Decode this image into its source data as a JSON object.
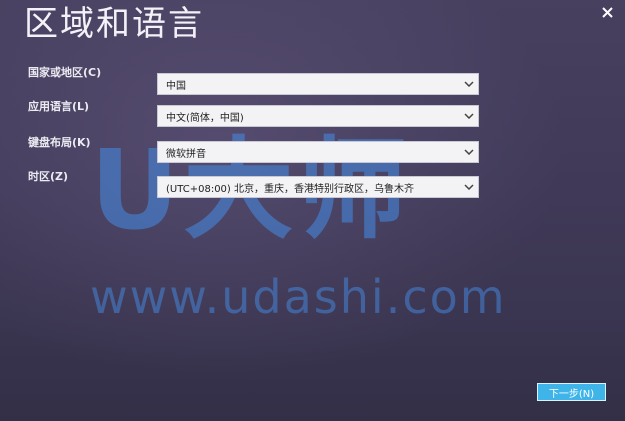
{
  "window": {
    "title": "区域和语言"
  },
  "fields": [
    {
      "label": "国家或地区(C)",
      "value": "中国"
    },
    {
      "label": "应用语言(L)",
      "value": "中文(简体，中国)"
    },
    {
      "label": "键盘布局(K)",
      "value": "微软拼音"
    },
    {
      "label": "时区(Z)",
      "value": "(UTC+08:00) 北京，重庆，香港特别行政区，乌鲁木齐"
    }
  ],
  "watermark": {
    "logo_text": "U大师",
    "url": "www.udashi.com"
  },
  "buttons": {
    "next_label": "下一步(N)"
  },
  "colors": {
    "background": "#403a58",
    "accent": "#3fb4e8",
    "watermark": "#468ce6"
  },
  "icons": {
    "close": "close-icon",
    "dropdown": "chevron-down-icon"
  }
}
